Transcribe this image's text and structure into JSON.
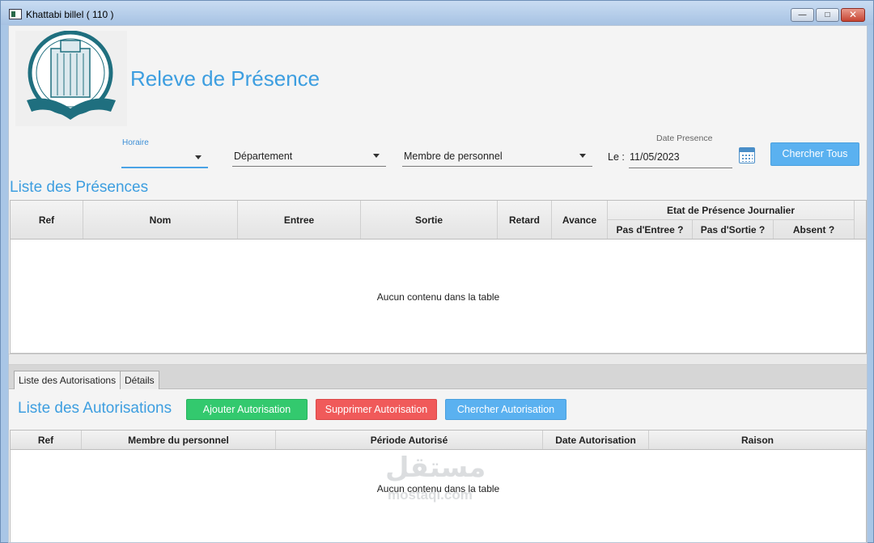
{
  "window": {
    "title": "Khattabi billel ( 110 )",
    "controls": {
      "minimize": "—",
      "maximize": "□",
      "close": "✕"
    }
  },
  "header": {
    "title": "Releve de Présence"
  },
  "filters": {
    "horaire_label": "Horaire",
    "horaire_value": "",
    "departement_placeholder": "Département",
    "membre_placeholder": "Membre de personnel",
    "date_label": "Date Presence",
    "le_label": "Le :",
    "date_value": "11/05/2023",
    "search_all_label": "Chercher Tous"
  },
  "presences": {
    "title": "Liste des Présences",
    "columns": [
      "Ref",
      "Nom",
      "Entree",
      "Sortie",
      "Retard",
      "Avance"
    ],
    "group_header": "Etat de Présence Journalier",
    "sub_columns": [
      "Pas d'Entree ?",
      "Pas d'Sortie ?",
      "Absent ?"
    ],
    "empty_message": "Aucun contenu dans la table"
  },
  "tabs": [
    {
      "label": "Liste des Autorisations",
      "active": true
    },
    {
      "label": "Détails",
      "active": false
    }
  ],
  "autorisations": {
    "title": "Liste des Autorisations",
    "add_label": "Ajouter Autorisation",
    "delete_label": "Supprimer Autorisation",
    "search_label": "Chercher Autorisation",
    "columns": [
      "Ref",
      "Membre du personnel",
      "Période Autorisé",
      "Date Autorisation",
      "Raison"
    ],
    "empty_message": "Aucun contenu dans la table"
  },
  "watermark": {
    "arabic": "مستقل",
    "latin": "mostaql.com"
  },
  "colors": {
    "accent": "#3d9ee0",
    "green": "#33c96e",
    "red": "#f05a5a",
    "blue": "#5ab1f0"
  }
}
